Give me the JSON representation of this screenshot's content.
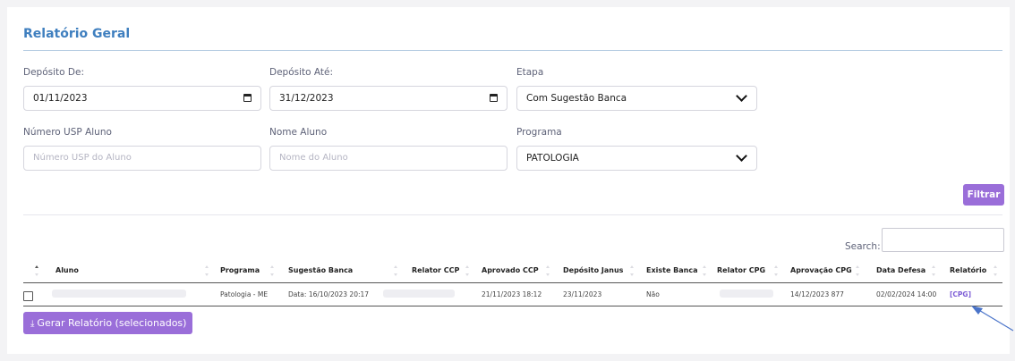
{
  "report": {
    "title": "Relatório Geral"
  },
  "filters": {
    "deposito_de": {
      "label": "Depósito De:",
      "value": "01/11/2023"
    },
    "deposito_ate": {
      "label": "Depósito Até:",
      "value": "31/12/2023"
    },
    "etapa": {
      "label": "Etapa",
      "value": "Com Sugestão Banca"
    },
    "numero_usp": {
      "label": "Número USP Aluno",
      "placeholder": "Número USP do Aluno"
    },
    "nome_aluno": {
      "label": "Nome Aluno",
      "placeholder": "Nome do Aluno"
    },
    "programa": {
      "label": "Programa",
      "value": "PATOLOGIA"
    },
    "filter_button": "Filtrar"
  },
  "table": {
    "search_label": "Search:",
    "columns": [
      "Aluno",
      "Programa",
      "Sugestão Banca",
      "Relator CCP",
      "Aprovado CCP",
      "Depósito Janus",
      "Existe Banca",
      "Relator CPG",
      "Aprovação CPG",
      "Data Defesa",
      "Relatório"
    ],
    "rows": [
      {
        "aluno": "",
        "programa": "Patologia - ME",
        "sugestao_banca": "Data: 16/10/2023 20:17",
        "relator_ccp": "",
        "aprovado_ccp": "21/11/2023 18:12",
        "deposito_janus": "23/11/2023",
        "existe_banca": "Não",
        "relator_cpg": "",
        "aprovacao_cpg": "14/12/2023 877",
        "data_defesa": "02/02/2024 14:00",
        "relatorio": "[CPG]"
      }
    ]
  },
  "actions": {
    "generate_report": "Gerar Relatório (selecionados)"
  },
  "icons": {
    "calendar": "calendar-icon",
    "chevron": "chevron-down-icon",
    "download": "download-icon",
    "arrow": "arrow-annotation-icon"
  },
  "colors": {
    "accent": "#9a6ed9",
    "title": "#3f7fbf",
    "link": "#7c5cd6",
    "annotation_arrow": "#4a74c9"
  }
}
